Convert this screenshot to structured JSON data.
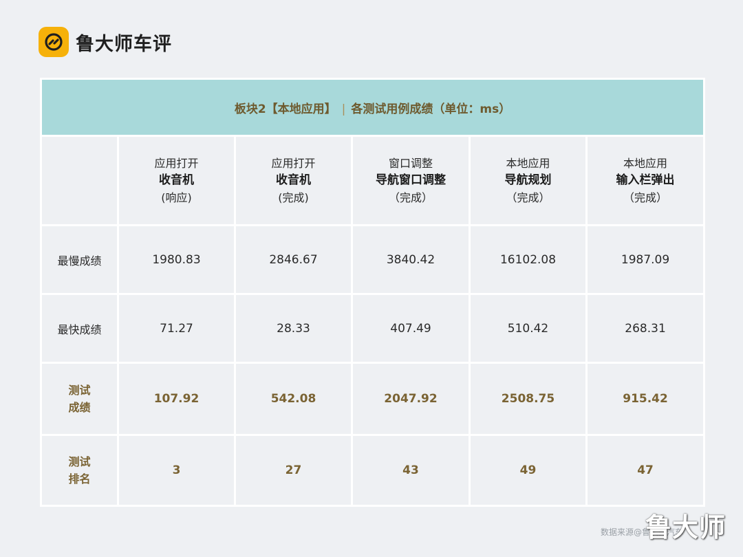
{
  "brand": {
    "name": "鲁大师车评",
    "logo_icon": "link-icon",
    "logo_color": "#f6b10a"
  },
  "table": {
    "title_left": "板块2【本地应用】",
    "title_sep": "|",
    "title_right": "各测试用例成绩（单位：ms）",
    "columns": [
      {
        "line1": "应用打开",
        "line2": "收音机",
        "line3": "(响应)"
      },
      {
        "line1": "应用打开",
        "line2": "收音机",
        "line3": "(完成)"
      },
      {
        "line1": "窗口调整",
        "line2": "导航窗口调整",
        "line3": "（完成）"
      },
      {
        "line1": "本地应用",
        "line2": "导航规划",
        "line3": "（完成）"
      },
      {
        "line1": "本地应用",
        "line2": "输入栏弹出",
        "line3": "（完成）"
      }
    ],
    "rows": {
      "slowest": {
        "label": "最慢成绩",
        "values": [
          "1980.83",
          "2846.67",
          "3840.42",
          "16102.08",
          "1987.09"
        ]
      },
      "fastest": {
        "label": "最快成绩",
        "values": [
          "71.27",
          "28.33",
          "407.49",
          "510.42",
          "268.31"
        ]
      },
      "score": {
        "label_line1": "测试",
        "label_line2": "成绩",
        "values": [
          "107.92",
          "542.08",
          "2047.92",
          "2508.75",
          "915.42"
        ]
      },
      "rank": {
        "label_line1": "测试",
        "label_line2": "排名",
        "values": [
          "3",
          "27",
          "43",
          "49",
          "47"
        ]
      }
    },
    "colors": {
      "title_bg": "#a8d9da",
      "highlight_text": "#7a6333"
    }
  },
  "footer": {
    "source": "数据来源@鲁大师汽车",
    "watermark": "鲁大师"
  }
}
